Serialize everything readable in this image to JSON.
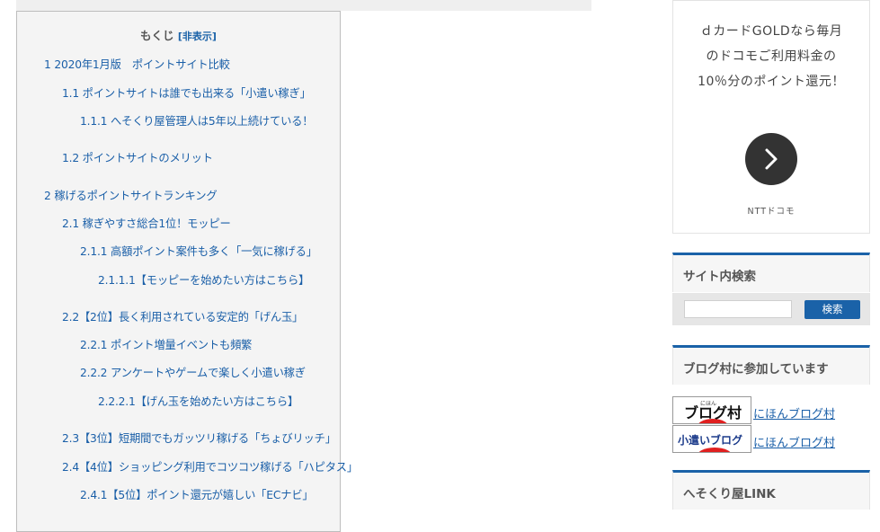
{
  "toc": {
    "title": "もくじ",
    "toggle": "[非表示]",
    "items": [
      "1 2020年1月版　ポイントサイト比較",
      "1.1 ポイントサイトは誰でも出来る「小遣い稼ぎ」",
      "1.1.1 へそくり屋管理人は5年以上続けている！",
      "1.2 ポイントサイトのメリット",
      "2 稼げるポイントサイトランキング",
      "2.1 稼ぎやすさ総合1位！モッピー",
      "2.1.1 高額ポイント案件も多く「一気に稼げる」",
      "2.1.1.1【モッピーを始めたい方はこちら】",
      "2.2【2位】長く利用されている安定的「げん玉」",
      "2.2.1 ポイント増量イベントも頻繁",
      "2.2.2 アンケートやゲームで楽しく小遣い稼ぎ",
      "2.2.2.1【げん玉を始めたい方はこちら】",
      "2.3【3位】短期間でもガッツリ稼げる「ちょびリッチ」",
      "2.4【4位】ショッピング利用でコツコツ稼げる「ハピタス」",
      "2.4.1【5位】ポイント還元が嬉しい「ECナビ」"
    ]
  },
  "ad": {
    "lines": [
      "ｄカードGOLDなら毎月",
      "のドコモご利用料金の",
      "10％分のポイント還元！"
    ],
    "footer": "NTTドコモ"
  },
  "search_widget": {
    "title": "サイト内検索",
    "button": "検索",
    "placeholder": ""
  },
  "blogmura_widget": {
    "title": "ブログ村に参加しています",
    "banners": [
      {
        "image_text": "ブログ村",
        "image_small": "にほん",
        "link": "にほんブログ村"
      },
      {
        "image_text": "小遣いブログ",
        "image_small": "",
        "link": "にほんブログ村"
      }
    ]
  },
  "link_widget": {
    "title": "へそくり屋LINK"
  },
  "colors": {
    "accent": "#1a62a8",
    "link": "#1a5fa8",
    "toc_bg": "#f4f4f4"
  }
}
